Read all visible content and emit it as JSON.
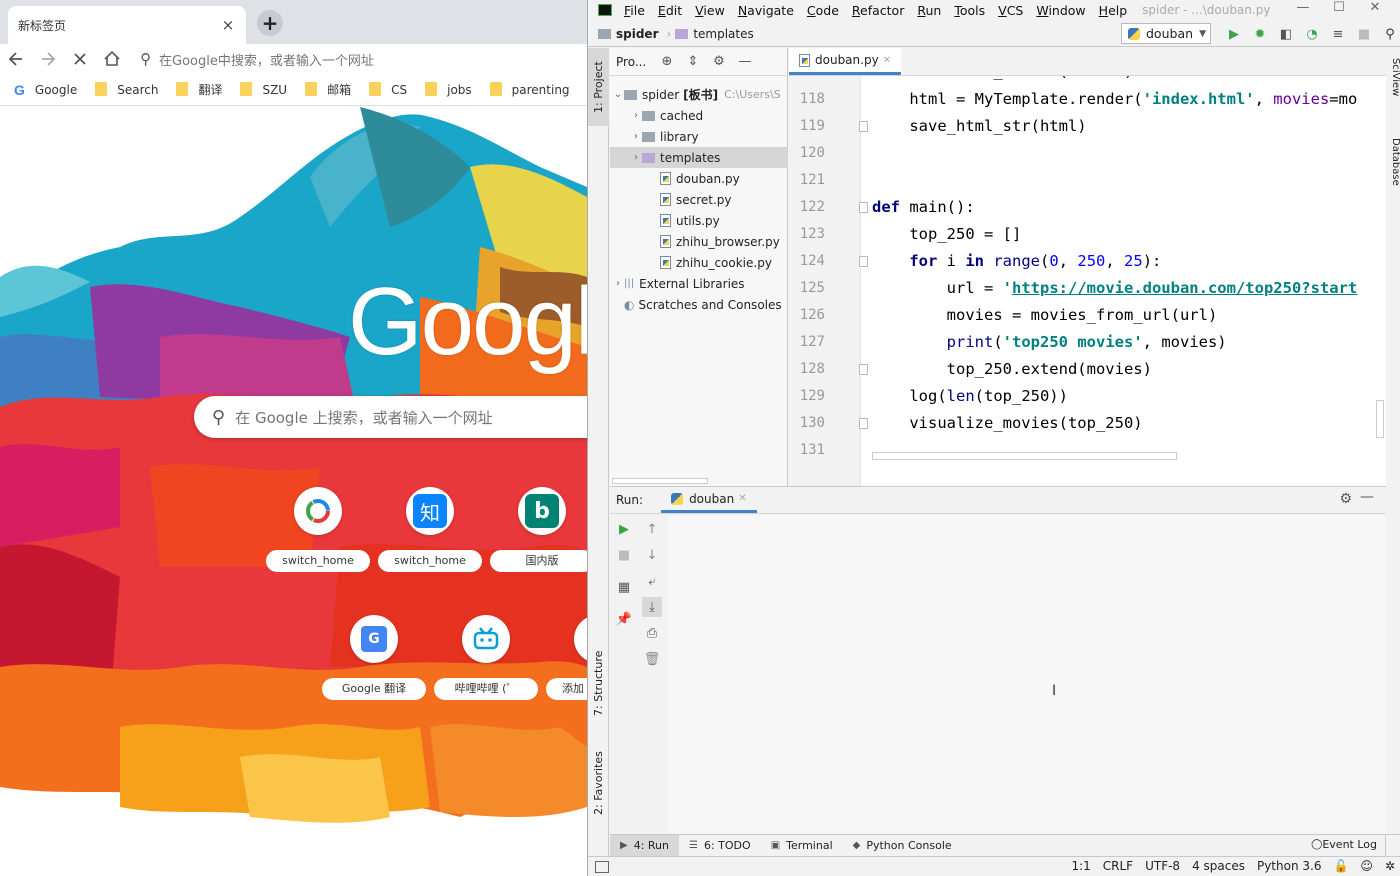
{
  "chrome": {
    "tab_title": "新标签页",
    "tab_close": "×",
    "new_tab": "+",
    "omnibox_placeholder": "在Google中搜索，或者输入一个网址",
    "bookmarks": [
      {
        "label": "Google",
        "icon": "google-icon"
      },
      {
        "label": "Search",
        "icon": "folder-icon"
      },
      {
        "label": "翻译",
        "icon": "folder-icon"
      },
      {
        "label": "SZU",
        "icon": "folder-icon"
      },
      {
        "label": "邮箱",
        "icon": "folder-icon"
      },
      {
        "label": "CS",
        "icon": "folder-icon"
      },
      {
        "label": "jobs",
        "icon": "folder-icon"
      },
      {
        "label": "parenting",
        "icon": "folder-icon"
      }
    ],
    "logo_text": "Google",
    "search_placeholder": "在 Google 上搜索，或者输入一个网址",
    "tiles": [
      {
        "label": "switch_home",
        "icon": "switch-home-icon"
      },
      {
        "label": "switch_home",
        "icon": "zhihu-icon",
        "glyph": "知"
      },
      {
        "label": "国内版",
        "icon": "bing-icon",
        "glyph": "b"
      },
      {
        "label": "Google 翻译",
        "icon": "google-translate-icon",
        "glyph": "G"
      },
      {
        "label": "哔哩哔哩 (゜",
        "icon": "bilibili-icon"
      },
      {
        "label": "添加",
        "icon": "add-shortcut-icon"
      }
    ]
  },
  "ide": {
    "menu": [
      {
        "u": "F",
        "rest": "ile"
      },
      {
        "u": "E",
        "rest": "dit"
      },
      {
        "u": "V",
        "rest": "iew"
      },
      {
        "u": "N",
        "rest": "avigate"
      },
      {
        "u": "C",
        "rest": "ode"
      },
      {
        "u": "R",
        "rest": "efactor"
      },
      {
        "u": "R",
        "rest": "un"
      },
      {
        "u": "T",
        "rest": "ools"
      },
      {
        "u": "V",
        "rest": "CS"
      },
      {
        "u": "W",
        "rest": "indow"
      },
      {
        "u": "H",
        "rest": "elp"
      }
    ],
    "window_title": "spider - ...\\douban.py",
    "breadcrumb": {
      "project": "spider",
      "folder": "templates"
    },
    "run_config": "douban",
    "left_tools": {
      "project": "1: Project",
      "structure": "7: Structure",
      "favorites": "2: Favorites"
    },
    "right_tools": {
      "sciview": "SciView",
      "database": "Database"
    },
    "project_header": "Pro...",
    "tree": [
      {
        "label": "spider",
        "suffix": "[板书]",
        "path": "C:\\Users\\S",
        "type": "folder",
        "indent": 0,
        "expanded": true
      },
      {
        "label": "cached",
        "type": "folder",
        "indent": 1
      },
      {
        "label": "library",
        "type": "folder",
        "indent": 1
      },
      {
        "label": "templates",
        "type": "folder",
        "indent": 1,
        "selected": true
      },
      {
        "label": "douban.py",
        "type": "py",
        "indent": 2
      },
      {
        "label": "secret.py",
        "type": "py",
        "indent": 2
      },
      {
        "label": "utils.py",
        "type": "py",
        "indent": 2
      },
      {
        "label": "zhihu_browser.py",
        "type": "py",
        "indent": 2
      },
      {
        "label": "zhihu_cookie.py",
        "type": "py",
        "indent": 2
      },
      {
        "label": "External Libraries",
        "type": "lib",
        "indent": 0
      },
      {
        "label": "Scratches and Consoles",
        "type": "scratch",
        "indent": 0
      }
    ],
    "editor_tab": "douban.py",
    "line_numbers": [
      "118",
      "119",
      "120",
      "121",
      "122",
      "123",
      "124",
      "125",
      "126",
      "127",
      "128",
      "129",
      "130",
      "131"
    ],
    "code_top_partial": "def visualize_movies(movies):",
    "code_lines": [
      [
        {
          "t": "    html = MyTemplate.render("
        },
        {
          "t": "'index.html'",
          "c": "str"
        },
        {
          "t": ", "
        },
        {
          "t": "movies",
          "c": "param"
        },
        {
          "t": "=mo"
        }
      ],
      [
        {
          "t": "    save_html_str(html)"
        }
      ],
      [],
      [],
      [
        {
          "t": "def",
          "c": "kw"
        },
        {
          "t": " main():"
        }
      ],
      [
        {
          "t": "    top_250 = []"
        }
      ],
      [
        {
          "t": "    "
        },
        {
          "t": "for",
          "c": "kw"
        },
        {
          "t": " i "
        },
        {
          "t": "in",
          "c": "kw"
        },
        {
          "t": " "
        },
        {
          "t": "range",
          "c": "bi"
        },
        {
          "t": "("
        },
        {
          "t": "0",
          "c": "num"
        },
        {
          "t": ", "
        },
        {
          "t": "250",
          "c": "num"
        },
        {
          "t": ", "
        },
        {
          "t": "25",
          "c": "num"
        },
        {
          "t": "):"
        }
      ],
      [
        {
          "t": "        url = "
        },
        {
          "t": "'",
          "c": "str"
        },
        {
          "t": "https://movie.douban.com/top250?start",
          "c": "url"
        }
      ],
      [
        {
          "t": "        movies = movies_from_url(url)"
        }
      ],
      [
        {
          "t": "        "
        },
        {
          "t": "print",
          "c": "bi"
        },
        {
          "t": "("
        },
        {
          "t": "'top250 movies'",
          "c": "str"
        },
        {
          "t": ", movies)"
        }
      ],
      [
        {
          "t": "        top_250.extend(movies)"
        }
      ],
      [
        {
          "t": "    log("
        },
        {
          "t": "len",
          "c": "bi"
        },
        {
          "t": "(top_250))"
        }
      ],
      [
        {
          "t": "    visualize_movies(top_250)"
        }
      ],
      []
    ],
    "run_label": "Run:",
    "run_tab": "douban",
    "bottom_tools": [
      {
        "label": "4: Run",
        "u": "4",
        "icon": "run-icon",
        "active": true
      },
      {
        "label": "6: TODO",
        "u": "6",
        "icon": "todo-icon"
      },
      {
        "label": "Terminal",
        "icon": "terminal-icon"
      },
      {
        "label": "Python Console",
        "icon": "python-console-icon"
      }
    ],
    "event_log": "Event Log",
    "status": {
      "position": "1:1",
      "line_sep": "CRLF",
      "encoding": "UTF-8",
      "indent": "4 spaces",
      "interpreter": "Python 3.6"
    }
  }
}
